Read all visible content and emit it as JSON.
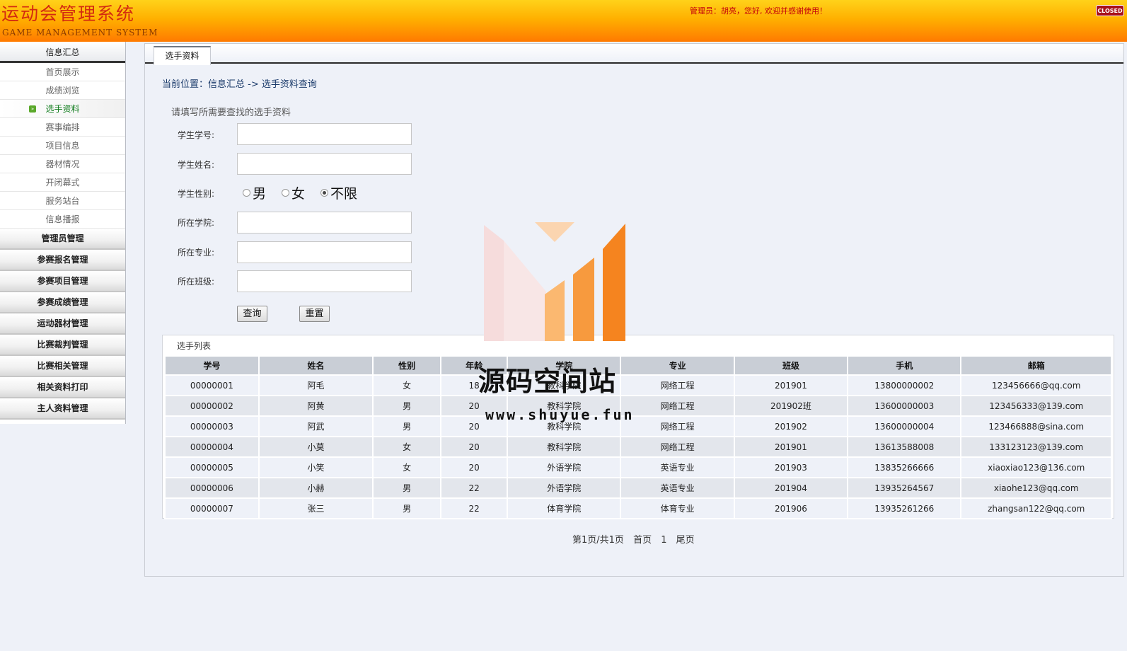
{
  "header": {
    "title_cn": "运动会管理系统",
    "title_en": "GAME  MANAGEMENT  SYSTEM",
    "welcome": "管理员：胡亮，您好, 欢迎并感谢使用！",
    "closed_label": "CLOSED"
  },
  "sidebar": {
    "head": "信息汇总",
    "sub_items": [
      {
        "label": "首页展示"
      },
      {
        "label": "成绩浏览"
      },
      {
        "label": "选手资料",
        "active": true
      },
      {
        "label": "赛事编排"
      },
      {
        "label": "项目信息"
      },
      {
        "label": "器材情况"
      },
      {
        "label": "开闭幕式"
      },
      {
        "label": "服务站台"
      },
      {
        "label": "信息播报"
      }
    ],
    "groups": [
      "管理员管理",
      "参赛报名管理",
      "参赛项目管理",
      "参赛成绩管理",
      "运动器材管理",
      "比赛裁判管理",
      "比赛相关管理",
      "相关资料打印",
      "主人资料管理"
    ]
  },
  "tab": {
    "label": "选手资料"
  },
  "breadcrumb": "当前位置：信息汇总 -> 选手资料查询",
  "form": {
    "title": "请填写所需要查找的选手资料",
    "fields": {
      "student_no": {
        "label": "学生学号:",
        "value": ""
      },
      "student_name": {
        "label": "学生姓名:",
        "value": ""
      },
      "gender": {
        "label": "学生性别:",
        "options": [
          "男",
          "女",
          "不限"
        ],
        "selected": "不限"
      },
      "college": {
        "label": "所在学院:",
        "value": ""
      },
      "major": {
        "label": "所在专业:",
        "value": ""
      },
      "class": {
        "label": "所在班级:",
        "value": ""
      }
    },
    "query_label": "查询",
    "reset_label": "重置"
  },
  "list": {
    "title": "选手列表",
    "columns": [
      "学号",
      "姓名",
      "性别",
      "年龄",
      "学院",
      "专业",
      "班级",
      "手机",
      "邮箱"
    ],
    "rows": [
      [
        "00000001",
        "阿毛",
        "女",
        "18",
        "教科学院",
        "网络工程",
        "201901",
        "13800000002",
        "123456666@qq.com"
      ],
      [
        "00000002",
        "阿黄",
        "男",
        "20",
        "教科学院",
        "网络工程",
        "201902班",
        "13600000003",
        "123456333@139.com"
      ],
      [
        "00000003",
        "阿武",
        "男",
        "20",
        "教科学院",
        "网络工程",
        "201902",
        "13600000004",
        "123466888@sina.com"
      ],
      [
        "00000004",
        "小莫",
        "女",
        "20",
        "教科学院",
        "网络工程",
        "201901",
        "13613588008",
        "133123123@139.com"
      ],
      [
        "00000005",
        "小笑",
        "女",
        "20",
        "外语学院",
        "英语专业",
        "201903",
        "13835266666",
        "xiaoxiao123@136.com"
      ],
      [
        "00000006",
        "小赫",
        "男",
        "22",
        "外语学院",
        "英语专业",
        "201904",
        "13935264567",
        "xiaohe123@qq.com"
      ],
      [
        "00000007",
        "张三",
        "男",
        "22",
        "体育学院",
        "体育专业",
        "201906",
        "13935261266",
        "zhangsan122@qq.com"
      ]
    ]
  },
  "pager": {
    "summary": "第1页/共1页",
    "first": "首页",
    "page": "1",
    "last": "尾页"
  },
  "watermark": {
    "title": "源码空间站",
    "url": "www.shuyue.fun"
  },
  "colors": {
    "header_top": "#ffd21a",
    "header_bottom": "#ff7a00",
    "accent_red": "#c4000c",
    "active_green": "#0b7a18",
    "watermark_orange": "#f5841f"
  }
}
